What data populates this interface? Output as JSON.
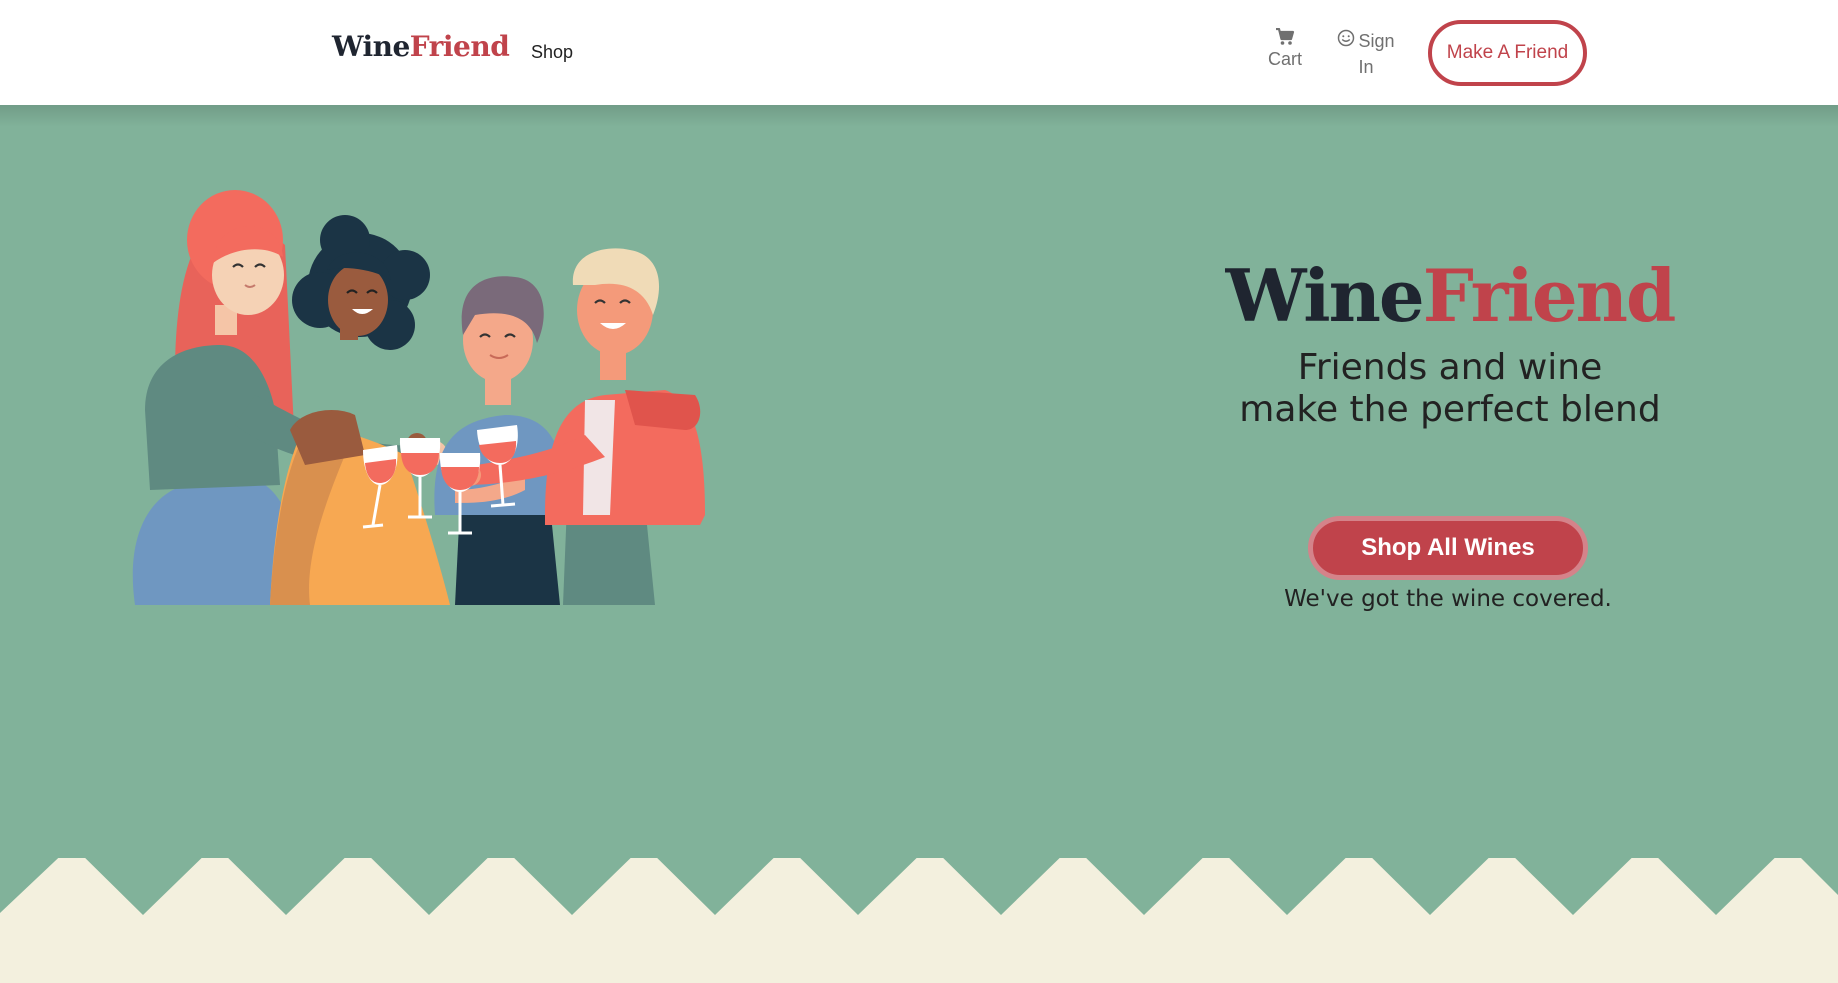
{
  "navbar": {
    "brand_part1": "Wine",
    "brand_part2": "Friend",
    "shop": "Shop",
    "cart": "Cart",
    "sign_in_line1": "Sign",
    "sign_in_line2": "In",
    "make_friend": "Make A Friend"
  },
  "hero": {
    "title_part1": "Wine",
    "title_part2": "Friend",
    "tagline_line1": "Friends and wine",
    "tagline_line2": "make the perfect blend",
    "shop_button": "Shop All Wines",
    "subtext": "We've got the wine covered."
  },
  "colors": {
    "brand_red": "#c0434b",
    "dark": "#1f2530",
    "hero_green": "#81b29a",
    "cream": "#f3f0de"
  },
  "icons": [
    "cart-icon",
    "smiley-icon"
  ]
}
